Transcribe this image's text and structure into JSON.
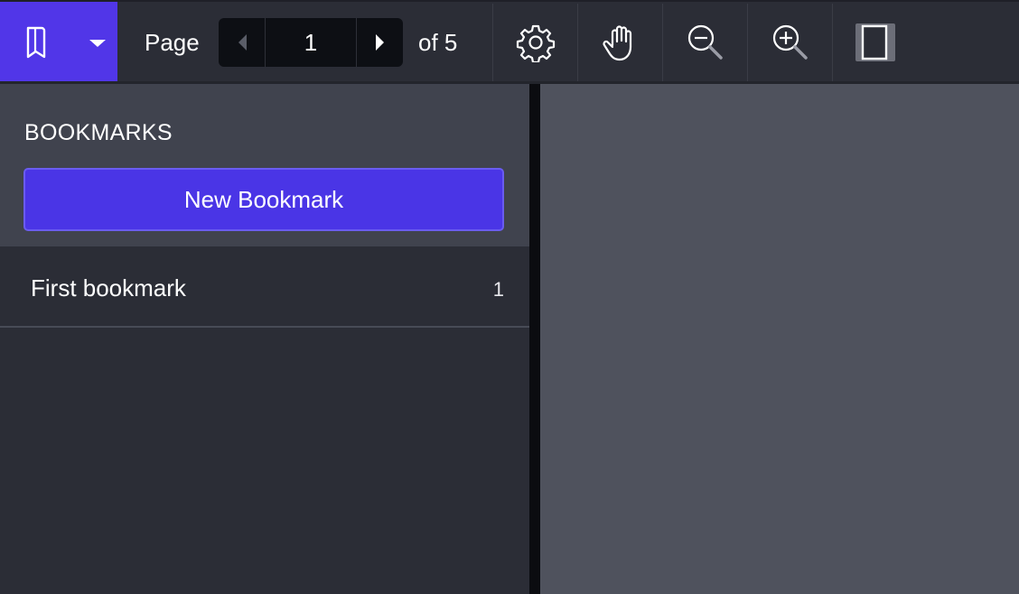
{
  "toolbar": {
    "bookmark_toggle_icon": "bookmark-icon",
    "dropdown_icon": "caret-down-icon",
    "page_label": "Page",
    "current_page": "1",
    "of_label": "of 5",
    "tools": [
      {
        "name": "settings",
        "icon": "gear-icon"
      },
      {
        "name": "pan",
        "icon": "hand-icon"
      },
      {
        "name": "zoom-out",
        "icon": "zoom-out-icon"
      },
      {
        "name": "zoom-in",
        "icon": "zoom-in-icon"
      },
      {
        "name": "page-layout",
        "icon": "single-page-icon"
      }
    ],
    "accent_color": "#5136e8"
  },
  "sidebar": {
    "title": "BOOKMARKS",
    "new_button_label": "New Bookmark",
    "items": [
      {
        "label": "First bookmark",
        "page": "1"
      }
    ]
  }
}
